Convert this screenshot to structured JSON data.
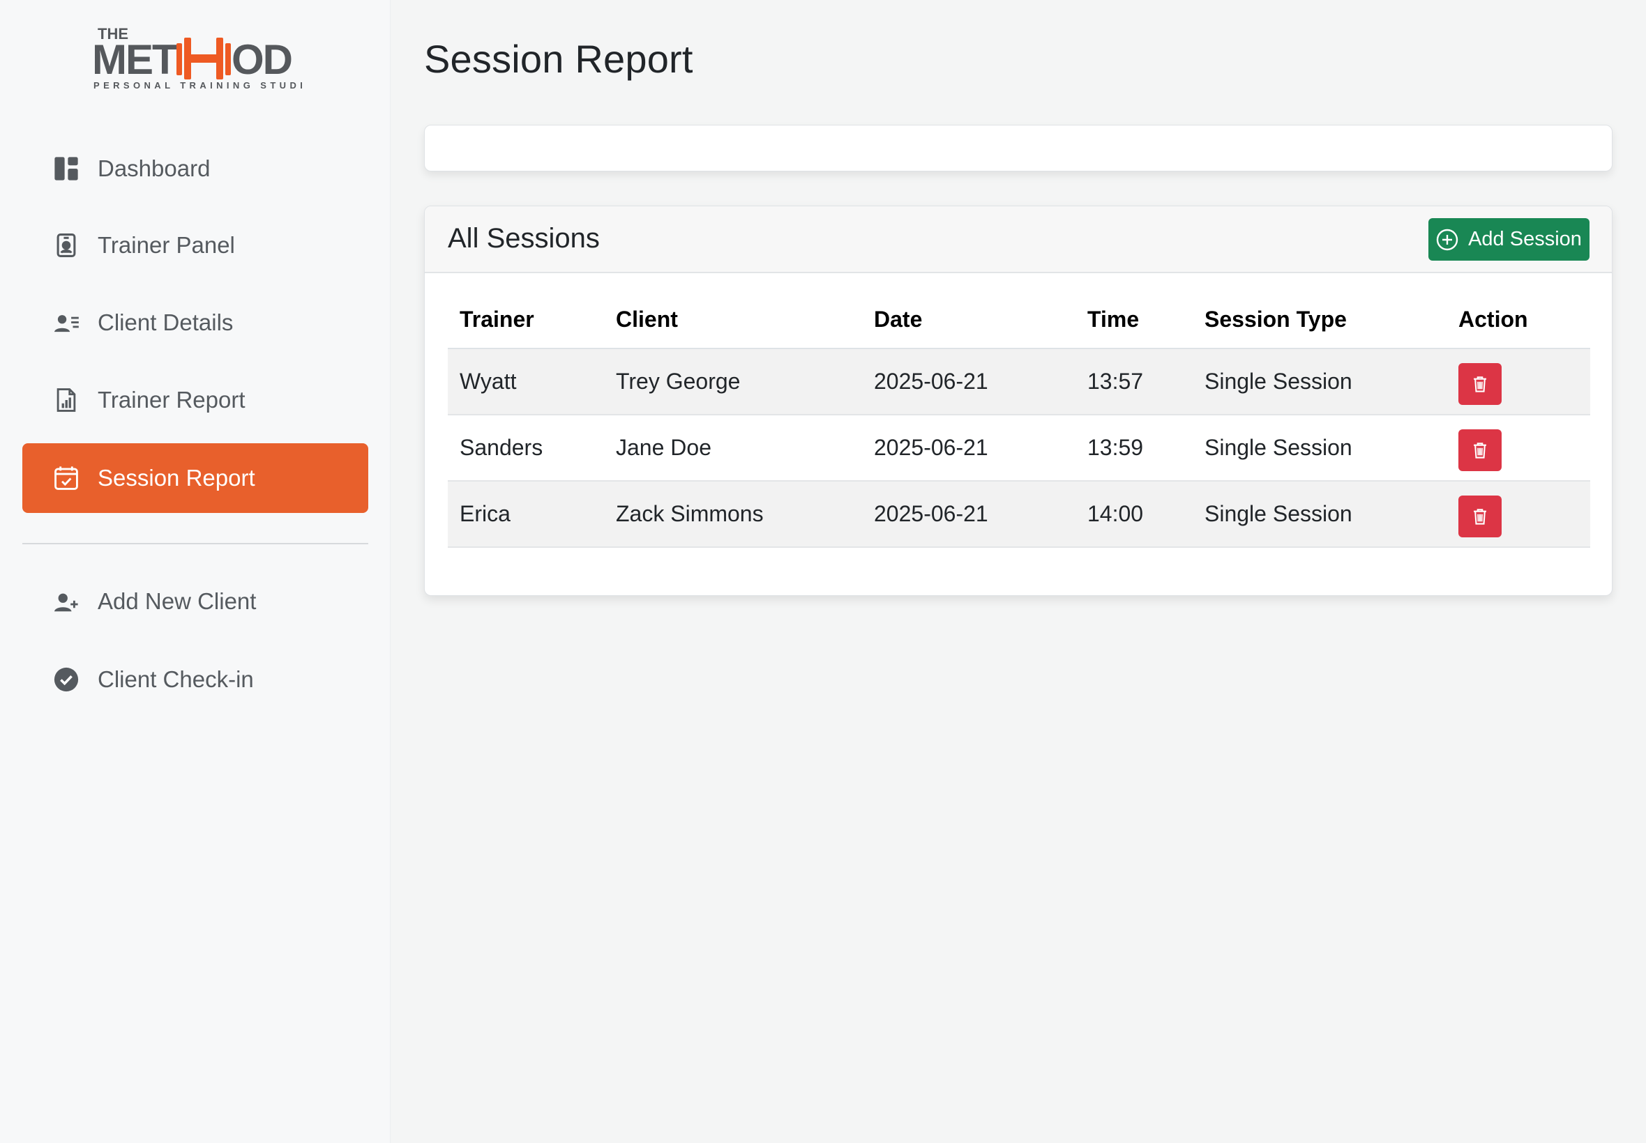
{
  "brand": {
    "logo_the": "THE",
    "logo_main_left": "MET",
    "logo_main_right": "OD",
    "logo_tagline": "PERSONAL TRAINING STUDIO",
    "accent_color": "#e8602c"
  },
  "sidebar": {
    "items": [
      {
        "label": "Dashboard",
        "icon": "dashboard-icon",
        "active": false
      },
      {
        "label": "Trainer Panel",
        "icon": "badge-icon",
        "active": false
      },
      {
        "label": "Client Details",
        "icon": "person-lines-icon",
        "active": false
      },
      {
        "label": "Trainer Report",
        "icon": "report-file-icon",
        "active": false
      },
      {
        "label": "Session Report",
        "icon": "calendar-check-icon",
        "active": true
      }
    ],
    "secondary_items": [
      {
        "label": "Add New Client",
        "icon": "person-add-icon"
      },
      {
        "label": "Client Check-in",
        "icon": "check-circle-icon"
      }
    ]
  },
  "main": {
    "title": "Session Report",
    "sessions_card": {
      "title": "All Sessions",
      "add_button_label": "Add Session",
      "add_button_color": "#198754",
      "delete_button_color": "#dc3545",
      "columns": [
        "Trainer",
        "Client",
        "Date",
        "Time",
        "Session Type",
        "Action"
      ],
      "rows": [
        {
          "trainer": "Wyatt",
          "client": "Trey George",
          "date": "2025-06-21",
          "time": "13:57",
          "type": "Single Session"
        },
        {
          "trainer": "Sanders",
          "client": "Jane Doe",
          "date": "2025-06-21",
          "time": "13:59",
          "type": "Single Session"
        },
        {
          "trainer": "Erica",
          "client": "Zack Simmons",
          "date": "2025-06-21",
          "time": "14:00",
          "type": "Single Session"
        }
      ]
    }
  }
}
